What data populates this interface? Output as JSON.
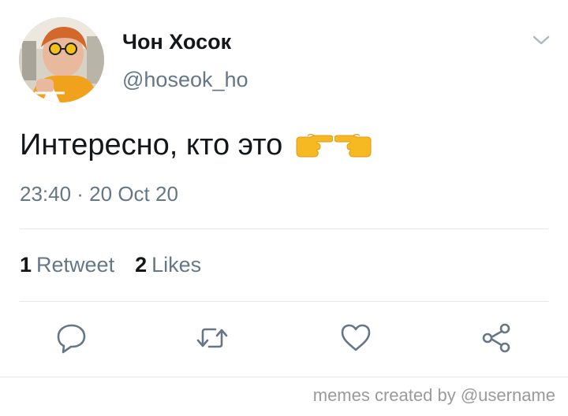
{
  "tweet": {
    "display_name": "Чон Хосок",
    "username": "@hoseok_ho",
    "text": "Интересно, кто это",
    "emoji": [
      "pointing-right-hand",
      "pointing-left-hand"
    ],
    "timestamp": "23:40 · 20 Oct 20",
    "stats": {
      "retweets_count": "1",
      "retweets_label": "Retweet",
      "likes_count": "2",
      "likes_label": "Likes"
    },
    "actions": [
      "reply-icon",
      "retweet-icon",
      "like-icon",
      "share-icon"
    ],
    "menu_icon": "chevron-down-icon"
  },
  "watermark": "memes created by @username",
  "colors": {
    "text_primary": "#14171a",
    "text_secondary": "#657786",
    "divider": "#e1e8ed",
    "icon": "#657786",
    "emoji_yellow": "#f7b922"
  }
}
